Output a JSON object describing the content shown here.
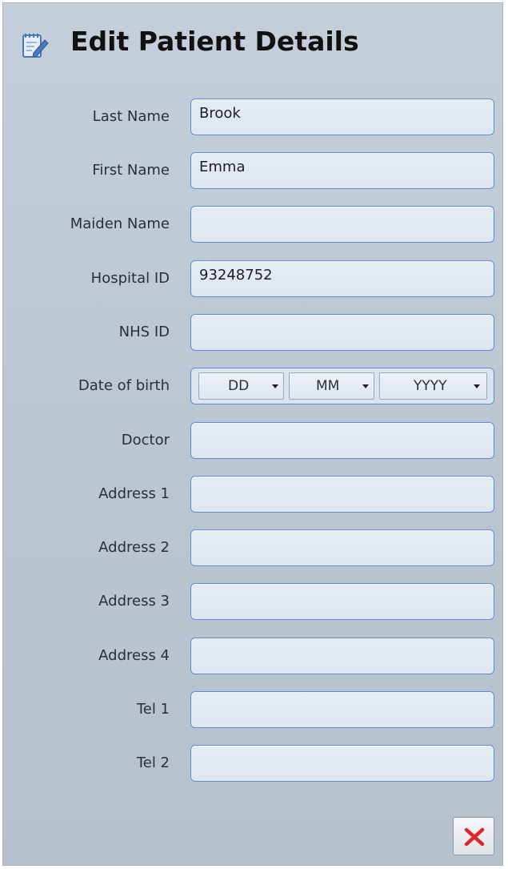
{
  "header": {
    "title": "Edit Patient Details",
    "icon": "edit-notepad-icon"
  },
  "fields": {
    "last_name": {
      "label": "Last Name",
      "value": "Brook"
    },
    "first_name": {
      "label": "First Name",
      "value": "Emma"
    },
    "maiden_name": {
      "label": "Maiden Name",
      "value": ""
    },
    "hospital_id": {
      "label": "Hospital ID",
      "value": "93248752"
    },
    "nhs_id": {
      "label": "NHS ID",
      "value": ""
    },
    "dob": {
      "label": "Date of birth",
      "day": "DD",
      "month": "MM",
      "year": "YYYY"
    },
    "doctor": {
      "label": "Doctor",
      "value": ""
    },
    "address1": {
      "label": "Address 1",
      "value": ""
    },
    "address2": {
      "label": "Address 2",
      "value": ""
    },
    "address3": {
      "label": "Address 3",
      "value": ""
    },
    "address4": {
      "label": "Address 4",
      "value": ""
    },
    "tel1": {
      "label": "Tel 1",
      "value": ""
    },
    "tel2": {
      "label": "Tel 2",
      "value": ""
    }
  },
  "actions": {
    "close_icon": "close-x-icon"
  },
  "colors": {
    "accent_border": "#5d8fcf",
    "close_red": "#e0242b",
    "panel_bg": "#c0cad6"
  }
}
